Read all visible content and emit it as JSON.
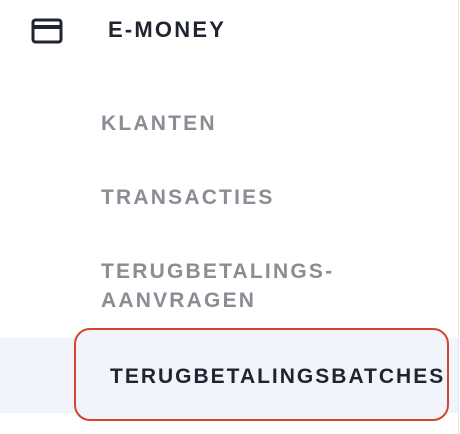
{
  "sidebar": {
    "section": {
      "icon": "credit-card-icon",
      "title": "E-MONEY"
    },
    "items": [
      {
        "label": "KLANTEN"
      },
      {
        "label": "TRANSACTIES"
      },
      {
        "label_lines": [
          "TERUGBETALINGS-",
          "AANVRAGEN"
        ]
      },
      {
        "label": "TERUGBETALINGSBATCHES",
        "active": true
      }
    ]
  },
  "colors": {
    "active_border": "#d6442e",
    "active_background": "#f1f5fb",
    "inactive_text": "#8a8d93",
    "active_text": "#1f2430"
  }
}
